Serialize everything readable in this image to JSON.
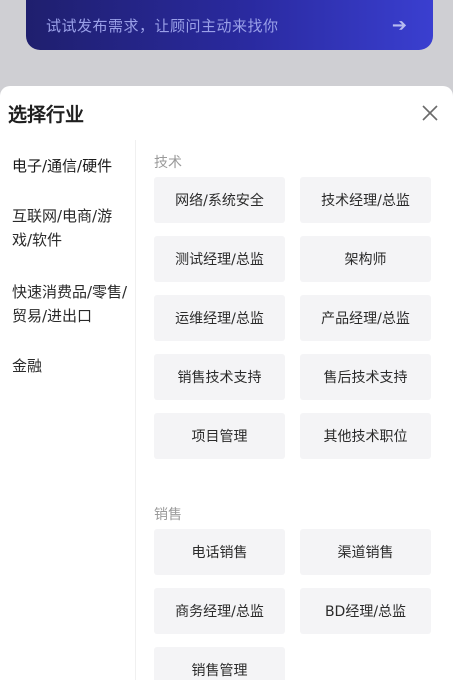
{
  "banner": {
    "text": "试试发布需求，让顾问主动来找你",
    "arrow_icon": "arrow-right-icon"
  },
  "sheet": {
    "title": "选择行业",
    "close_icon": "close-icon"
  },
  "categories": [
    {
      "label": "电子/通信/硬件",
      "active": true
    },
    {
      "label": "互联网/电商/游戏/软件"
    },
    {
      "label": "快速消费品/零售/贸易/进出口"
    },
    {
      "label": "金融"
    }
  ],
  "sections": [
    {
      "title": "技术",
      "tags": [
        "网络/系统安全",
        "技术经理/总监",
        "测试经理/总监",
        "架构师",
        "运维经理/总监",
        "产品经理/总监",
        "销售技术支持",
        "售后技术支持",
        "项目管理",
        "其他技术职位"
      ]
    },
    {
      "title": "销售",
      "tags": [
        "电话销售",
        "渠道销售",
        "商务经理/总监",
        "BD经理/总监",
        "销售管理"
      ]
    }
  ],
  "colors": {
    "accent": "#2a56e8",
    "tag_bg": "#f4f4f6",
    "banner_start": "#1f1f6e",
    "banner_end": "#3a3fd0"
  }
}
